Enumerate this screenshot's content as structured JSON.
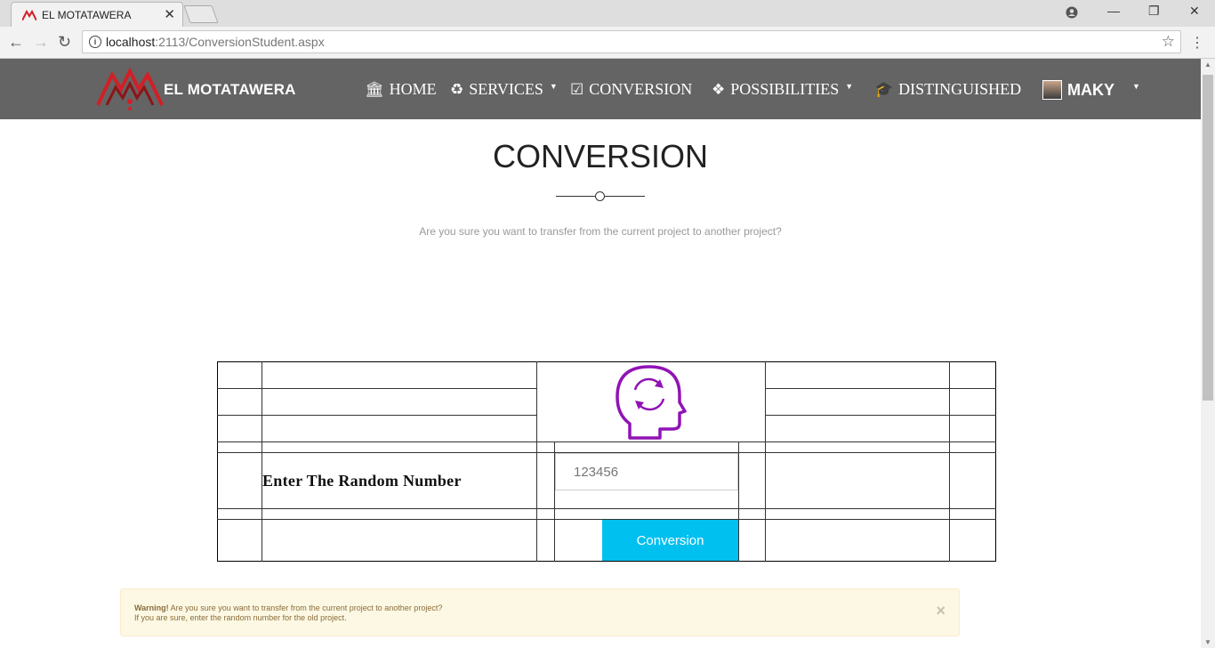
{
  "browser": {
    "tab_title": "EL MOTATAWERA",
    "tab_close": "✕",
    "url_host": "localhost",
    "url_rest": ":2113/ConversionStudent.aspx",
    "window_controls": [
      "⚫",
      "—",
      "❐",
      "✕"
    ]
  },
  "navbar": {
    "brand": "EL MOTATAWERA",
    "items": [
      {
        "label": "HOME",
        "icon": "bank-icon",
        "dropdown": false
      },
      {
        "label": "SERVICES",
        "icon": "recycle-icon",
        "dropdown": true
      },
      {
        "label": "CONVERSION",
        "icon": "checkbox-icon",
        "dropdown": false
      },
      {
        "label": "POSSIBILITIES",
        "icon": "cubes-icon",
        "dropdown": true
      },
      {
        "label": "DISTINGUISHED",
        "icon": "graduation-cap-icon",
        "dropdown": false
      }
    ],
    "user": "MAKY"
  },
  "main": {
    "title": "CONVERSION",
    "subtitle": "Are you sure you want to transfer from the current project to another project?",
    "form": {
      "label": "Enter The Random Number",
      "input_placeholder": "123456",
      "button_label": "Conversion"
    },
    "alert": {
      "strong": "Warning!",
      "line1": " Are you sure you want to transfer from the current project to another project?",
      "line2": "If you are sure, enter the random number for the old project.",
      "close": "×"
    }
  },
  "colors": {
    "navbar_bg": "#646464",
    "brand_red": "#d21f26",
    "accent_button": "#00c0f0",
    "icon_purple": "#9013b5",
    "alert_bg": "#fcf8e3"
  }
}
